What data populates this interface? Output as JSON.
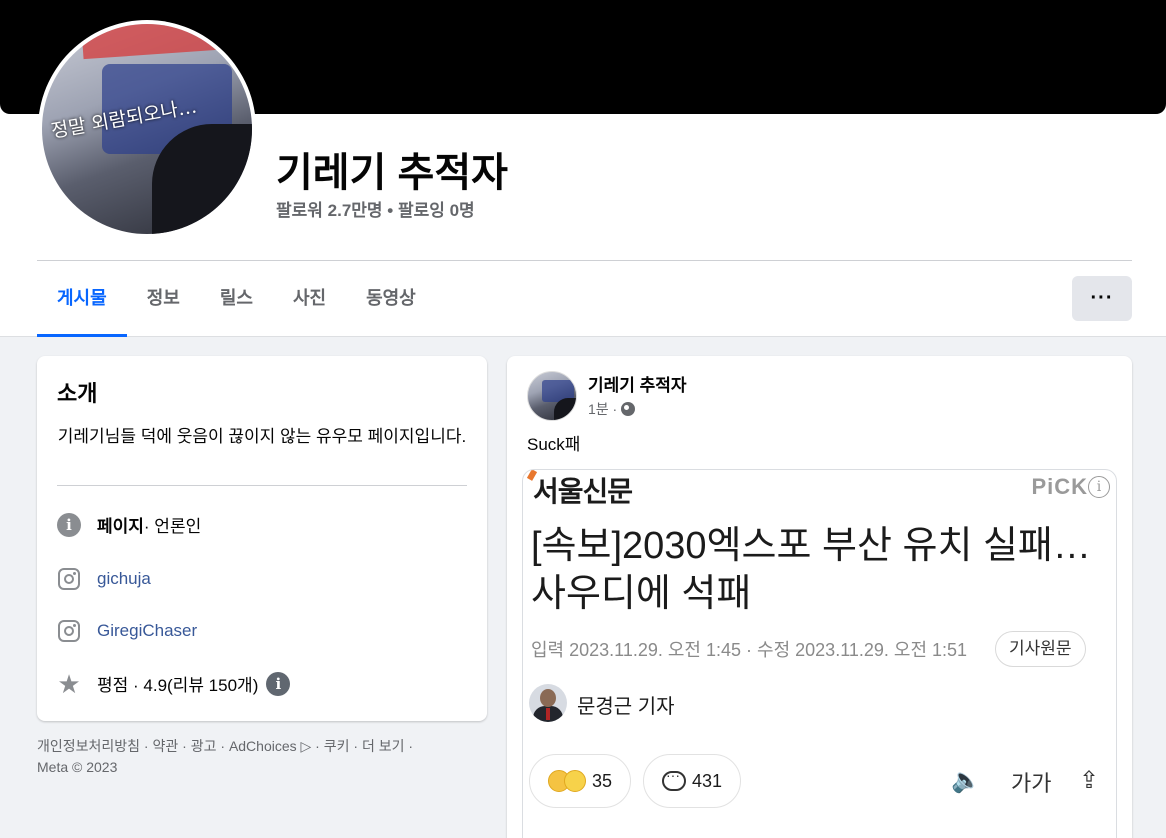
{
  "profile": {
    "name": "기레기 추적자",
    "stats": "팔로워 2.7만명 • 팔로잉 0명",
    "avatar_caption": "정말 외람되오나…"
  },
  "tabs": [
    "게시물",
    "정보",
    "릴스",
    "사진",
    "동영상"
  ],
  "more_label": "···",
  "intro": {
    "title": "소개",
    "description": "기레기님들 덕에 웃음이 끊이지 않는 유우모 페이지입니다.",
    "category_label": "페이지",
    "category_value": " · 언론인",
    "instagram_1": "gichuja",
    "instagram_2": "GiregiChaser",
    "rating": "평점 · 4.9(리뷰 150개)"
  },
  "footer": {
    "links": [
      "개인정보처리방침",
      "약관",
      "광고",
      "AdChoices ▷",
      "쿠키",
      "더 보기"
    ],
    "copyright": "Meta © 2023"
  },
  "post": {
    "author": "기레기 추적자",
    "time": "1분 ·",
    "text": "Suck패",
    "article": {
      "brand": "서울신문",
      "pick": "PiCK",
      "headline": "[속보]2030엑스포 부산 유치 실패… 사우디에 석패",
      "dates": "입력 2023.11.29. 오전 1:45 · 수정 2023.11.29. 오전 1:51",
      "original_button": "기사원문",
      "reporter": "문경근 기자",
      "reactions_count": "35",
      "comments_count": "431",
      "font_button": "가가"
    }
  },
  "colors": {
    "accent": "#0866ff",
    "cover": "#000000",
    "background": "#f0f2f5"
  }
}
